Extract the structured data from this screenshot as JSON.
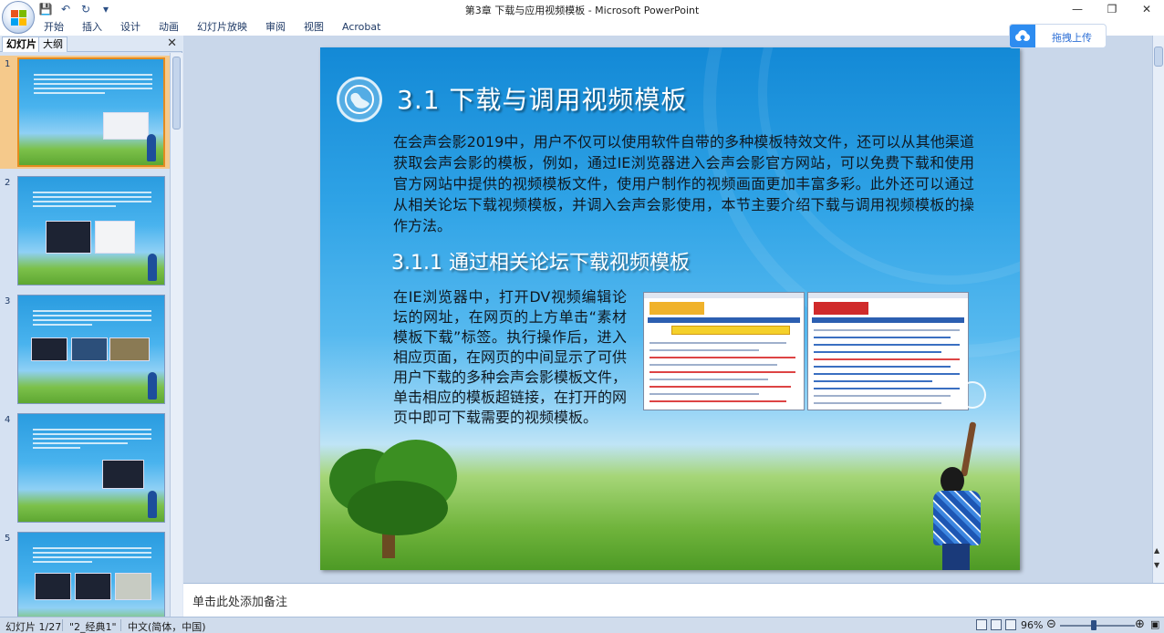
{
  "window": {
    "title": "第3章  下载与应用视频模板 - Microsoft PowerPoint",
    "controls": [
      "minimize-icon",
      "restore-icon",
      "close-icon"
    ]
  },
  "quick_access": [
    "save-icon",
    "undo-icon",
    "redo-icon",
    "customize-icon"
  ],
  "ribbon": {
    "tabs": [
      "开始",
      "插入",
      "设计",
      "动画",
      "幻灯片放映",
      "审阅",
      "视图",
      "Acrobat"
    ],
    "upload_button": "拖拽上传"
  },
  "left_pane": {
    "tabs": [
      "幻灯片",
      "大纲"
    ],
    "slides": [
      {
        "number": "1",
        "selected": true
      },
      {
        "number": "2",
        "selected": false
      },
      {
        "number": "3",
        "selected": false
      },
      {
        "number": "4",
        "selected": false
      },
      {
        "number": "5",
        "selected": false
      }
    ]
  },
  "slide": {
    "title": "3.1  下载与调用视频模板",
    "intro": "在会声会影2019中，用户不仅可以使用软件自带的多种模板特效文件，还可以从其他渠道获取会声会影的模板，例如，通过IE浏览器进入会声会影官方网站，可以免费下载和使用官方网站中提供的视频模板文件，使用户制作的视频画面更加丰富多彩。此外还可以通过从相关论坛下载视频模板，并调入会声会影使用，本节主要介绍下载与调用视频模板的操作方法。",
    "subtitle": "3.1.1  通过相关论坛下载视频模板",
    "body": "在IE浏览器中，打开DV视频编辑论坛的网址，在网页的上方单击“素材模板下载”标签。执行操作后，进入相应页面，在网页的中间显示了可供用户下载的多种会声会影模板文件，单击相应的模板超链接，在打开的网页中即可下载需要的视频模板。"
  },
  "notes": {
    "placeholder": "单击此处添加备注"
  },
  "status_bar": {
    "slide_info": "幻灯片 1/27",
    "theme": "\"2_经典1\"",
    "language": "中文(简体，中国)",
    "zoom": "96%"
  }
}
